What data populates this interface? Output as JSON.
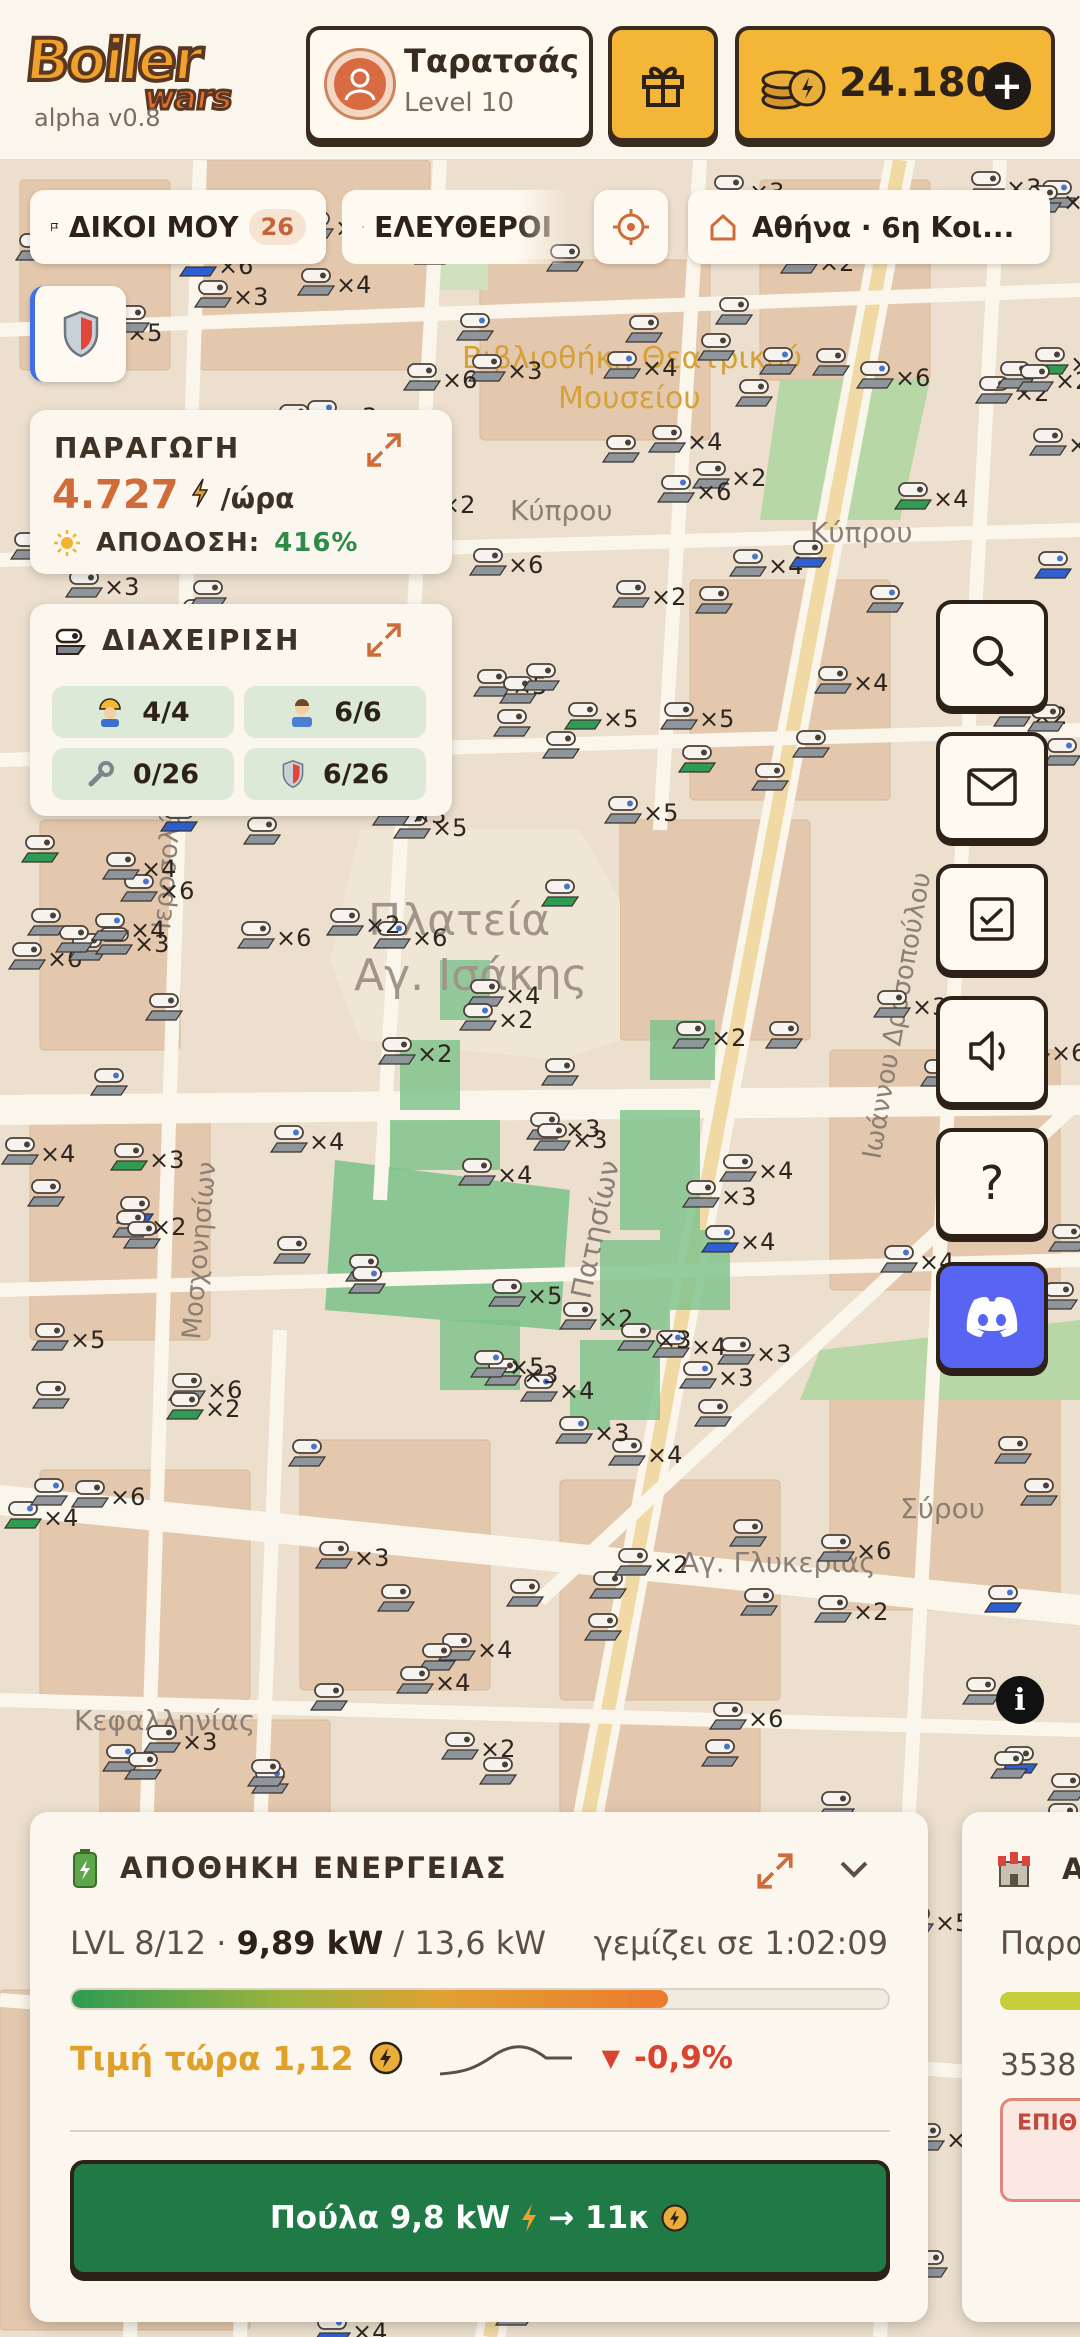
{
  "app": {
    "logo_word1": "Boiler",
    "logo_word2": "wars",
    "version": "alpha v0.8"
  },
  "user": {
    "name": "Ταρατσάς",
    "level": "Level 10"
  },
  "coins": {
    "amount": "24.180"
  },
  "filters": {
    "mine_label": "ΔΙΚΟΙ ΜΟΥ",
    "mine_count": "26",
    "free_label": "ΕΛΕΥΘΕΡΟΙ",
    "location": "Αθήνα · 6η Κοι..."
  },
  "production": {
    "title": "ΠΑΡΑΓΩΓΗ",
    "value": "4.727",
    "unit": "/ώρα",
    "efficiency_label": "ΑΠΟΔΟΣΗ:",
    "efficiency_value": "416%"
  },
  "management": {
    "title": "ΔΙΑΧΕΙΡΙΣΗ",
    "tiles": [
      {
        "icon": "worker-icon",
        "value": "4/4"
      },
      {
        "icon": "technician-icon",
        "value": "6/6"
      },
      {
        "icon": "wrench-icon",
        "value": "0/26"
      },
      {
        "icon": "shield-icon",
        "value": "6/26"
      }
    ]
  },
  "map_labels": {
    "library": "Βιβλιοθήκη Θεατρικού Μουσείου",
    "square": "Πλατεία Αγ. Ισάκης",
    "kyprou": "Κύπρου",
    "patision": "Πατησίων",
    "kefallinias": "Κεφαλληνίας",
    "drosopoulou": "Ιωάννου Δροσοπούλου",
    "mosxonision": "Μοσχονησίων",
    "syrou": "Σύρου",
    "ag_glykerias": "Αγ. Γλυκερίας",
    "ierosolymon": "Ιεροσολύμων"
  },
  "storage": {
    "title": "ΑΠΟΘΗΚΗ ΕΝΕΡΓΕΙΑΣ",
    "level": "LVL 8/12 · ",
    "current": "9,89 kW",
    "capacity": " / 13,6 kW",
    "fill_time": "γεμίζει σε 1:02:09",
    "fill_fraction": 0.73,
    "price_label": "Τιμή τώρα 1,12",
    "price_delta": "-0,9%",
    "sell_label": "Πούλα 9,8 kW",
    "sell_arrow": "→ 11κ"
  },
  "storage2": {
    "title": "Α",
    "label": "Παρα",
    "value": "3538",
    "tag": "ΕΠΙΘ"
  },
  "colors": {
    "accent": "#d06b3a",
    "gold": "#f4b637",
    "green": "#1f7a45",
    "discord": "#5865f2"
  }
}
